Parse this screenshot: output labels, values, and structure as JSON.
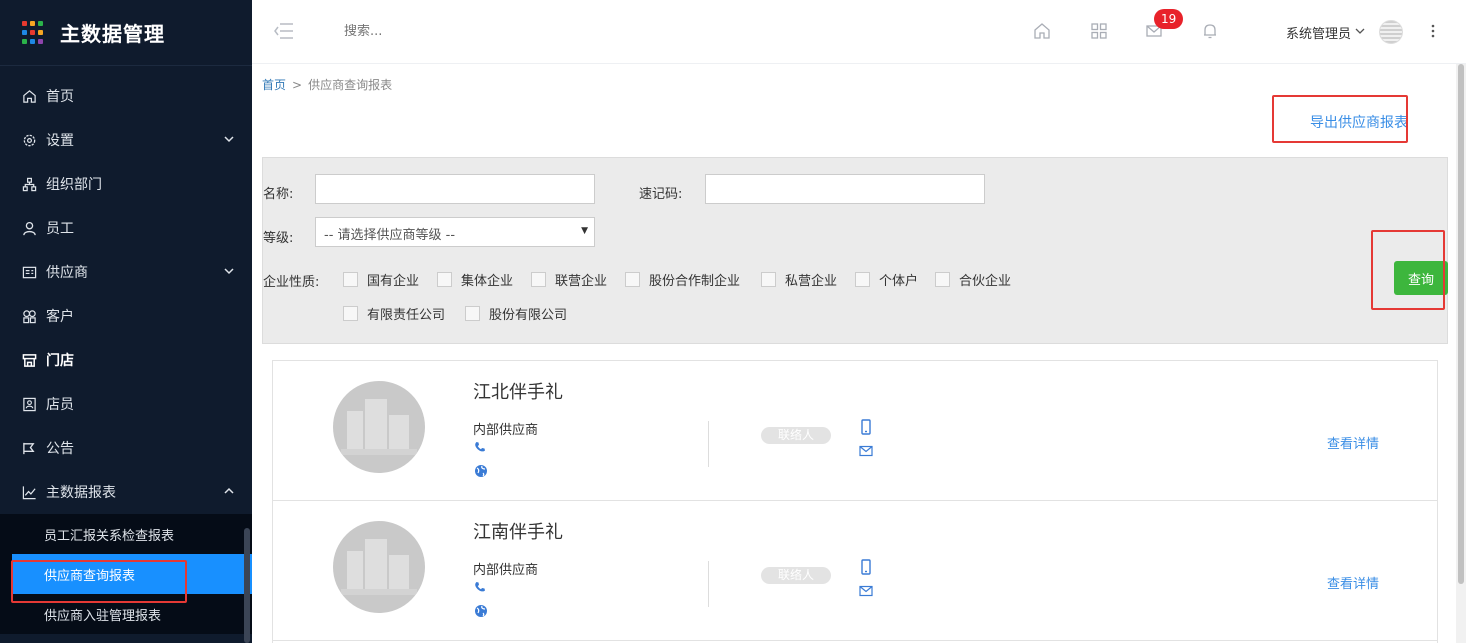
{
  "app": {
    "title": "主数据管理"
  },
  "brand_dot_colors": [
    "#e8392f",
    "#f6a623",
    "#2bb34a",
    "#1e88e5",
    "#e8392f",
    "#f6a623",
    "#2bb34a",
    "#1e88e5",
    "#8e44ad"
  ],
  "sidebar": {
    "items": [
      {
        "label": "首页",
        "icon": "home-icon"
      },
      {
        "label": "设置",
        "icon": "gear-icon",
        "arrow": "down"
      },
      {
        "label": "组织部门",
        "icon": "org-icon"
      },
      {
        "label": "员工",
        "icon": "user-icon"
      },
      {
        "label": "供应商",
        "icon": "vendor-icon",
        "arrow": "down"
      },
      {
        "label": "客户",
        "icon": "customer-icon"
      },
      {
        "label": "门店",
        "icon": "store-icon"
      },
      {
        "label": "店员",
        "icon": "clerk-icon"
      },
      {
        "label": "公告",
        "icon": "notice-icon"
      },
      {
        "label": "主数据报表",
        "icon": "chart-icon",
        "arrow": "up"
      }
    ],
    "sub_items": [
      {
        "label": "员工汇报关系检查报表"
      },
      {
        "label": "供应商查询报表",
        "active": true
      },
      {
        "label": "供应商入驻管理报表"
      }
    ]
  },
  "topbar": {
    "search_placeholder": "搜索...",
    "mail_badge": "19",
    "user_name": "系统管理员"
  },
  "breadcrumb": {
    "home": "首页",
    "separator": ">",
    "current": "供应商查询报表"
  },
  "export_label": "导出供应商报表",
  "filter": {
    "name_label": "名称:",
    "name_value": "",
    "code_label": "速记码:",
    "code_value": "",
    "level_label": "等级:",
    "level_selected": "-- 请选择供应商等级 --",
    "nature_label": "企业性质:",
    "natures": [
      "国有企业",
      "集体企业",
      "联营企业",
      "股份合作制企业",
      "私营企业",
      "个体户",
      "合伙企业",
      "有限责任公司",
      "股份有限公司"
    ],
    "query_label": "查询"
  },
  "suppliers": [
    {
      "name": "江北伴手礼",
      "type": "内部供应商",
      "contact": "联络人",
      "detail": "查看详情"
    },
    {
      "name": "江南伴手礼",
      "type": "内部供应商",
      "contact": "联络人",
      "detail": "查看详情"
    }
  ],
  "colors": {
    "sidebar_bg": "#0f1b2d",
    "active_item": "#1890ff",
    "query_btn": "#3db63d",
    "link": "#3a8ee6",
    "badge": "#e8222a",
    "highlight_box": "#e53935"
  }
}
